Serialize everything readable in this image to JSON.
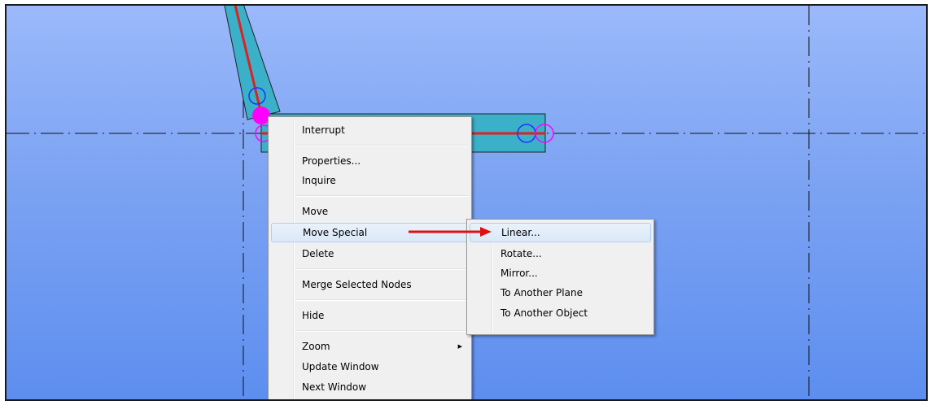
{
  "context_menu": {
    "items": [
      {
        "label": "Interrupt"
      },
      {
        "label": "Properties..."
      },
      {
        "label": "Inquire"
      },
      {
        "label": "Move"
      },
      {
        "label": "Move Special"
      },
      {
        "label": "Delete"
      },
      {
        "label": "Merge Selected Nodes"
      },
      {
        "label": "Hide"
      },
      {
        "label": "Zoom"
      },
      {
        "label": "Update Window"
      },
      {
        "label": "Next Window"
      }
    ]
  },
  "submenu": {
    "items": [
      {
        "label": "Linear..."
      },
      {
        "label": "Rotate..."
      },
      {
        "label": "Mirror..."
      },
      {
        "label": "To Another Plane"
      },
      {
        "label": "To Another Object"
      }
    ]
  },
  "colors": {
    "member_fill": "#3bb0c9",
    "member_line": "#e02020",
    "node_selected": "#ff00ff",
    "node_circle": "#1a33ff",
    "annotation_arrow": "#e01010"
  },
  "icons": {
    "submenu_arrow": "chevron-right-icon"
  }
}
